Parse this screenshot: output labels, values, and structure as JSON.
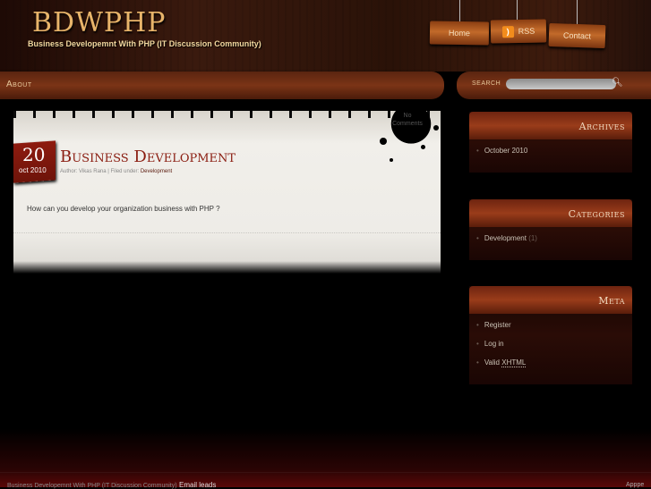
{
  "site": {
    "title": "BDWPHP",
    "tagline": "Business Developemnt With PHP (IT Discussion Community)"
  },
  "top_nav": {
    "home": "Home",
    "rss": "RSS",
    "contact": "Contact"
  },
  "nav": {
    "about": "About"
  },
  "search": {
    "label": "SEARCH",
    "placeholder": ""
  },
  "post": {
    "day": "20",
    "month_year": "oct 2010",
    "title": "Business Development",
    "author_prefix": "Author: ",
    "author": "Vikas Rana",
    "filed_prefix": " | Filed under: ",
    "category": "Development",
    "comments_line1": "No",
    "comments_line2": "Comments",
    "body": "How can you develop your organization business with PHP ?"
  },
  "widgets": {
    "archives": {
      "title": "Archives",
      "items": [
        "October 2010"
      ]
    },
    "categories": {
      "title": "Categories",
      "item": "Development",
      "count": "(1)"
    },
    "meta": {
      "title": "Meta",
      "items": [
        "Register",
        "Log in",
        "Valid "
      ],
      "xhtml": "XHTML"
    }
  },
  "footer": {
    "left": "Business Developemnt With PHP (IT Discussion Community)",
    "email": "Email leads",
    "right": "Apppe"
  },
  "colors": {
    "accent": "#8a1c10",
    "logo": "#e8b46a",
    "wood": "#7b3416"
  }
}
